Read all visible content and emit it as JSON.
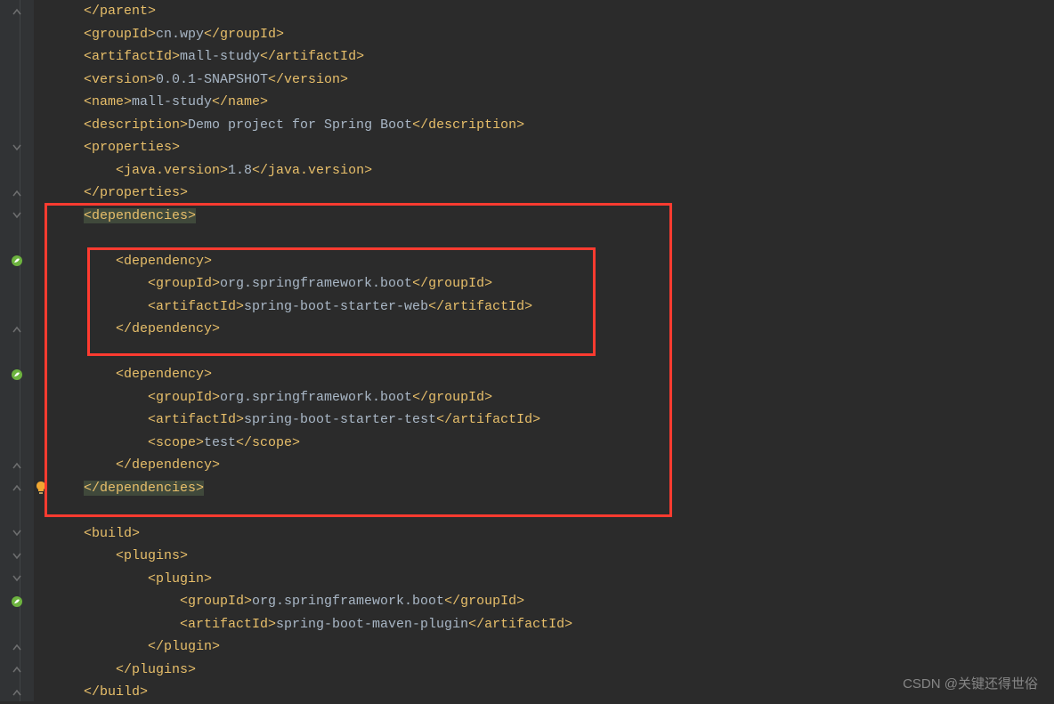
{
  "watermark": "CSDN @关键还得世俗",
  "groupId_val": "cn.wpy",
  "artifactId_val": "mall-study",
  "version_val": "0.0.1-SNAPSHOT",
  "name_val": "mall-study",
  "description_val": "Demo project for Spring Boot",
  "java_version_val": "1.8",
  "dep1_group": "org.springframework.boot",
  "dep1_artifact": "spring-boot-starter-web",
  "dep2_group": "org.springframework.boot",
  "dep2_artifact": "spring-boot-starter-test",
  "dep2_scope": "test",
  "plugin_group": "org.springframework.boot",
  "plugin_artifact": "spring-boot-maven-plugin",
  "tags": {
    "parent_close": "</parent>",
    "groupId_o": "<groupId>",
    "groupId_c": "</groupId>",
    "artifactId_o": "<artifactId>",
    "artifactId_c": "</artifactId>",
    "version_o": "<version>",
    "version_c": "</version>",
    "name_o": "<name>",
    "name_c": "</name>",
    "description_o": "<description>",
    "description_c": "</description>",
    "properties_o": "<properties>",
    "properties_c": "</properties>",
    "javaversion_o": "<java.version>",
    "javaversion_c": "</java.version>",
    "dependencies_o": "<dependencies>",
    "dependencies_c": "</dependencies>",
    "dependency_o": "<dependency>",
    "dependency_c": "</dependency>",
    "scope_o": "<scope>",
    "scope_c": "</scope>",
    "build_o": "<build>",
    "build_c": "</build>",
    "plugins_o": "<plugins>",
    "plugins_c": "</plugins>",
    "plugin_o": "<plugin>",
    "plugin_c": "</plugin>",
    "deps_close_gt": ">"
  }
}
